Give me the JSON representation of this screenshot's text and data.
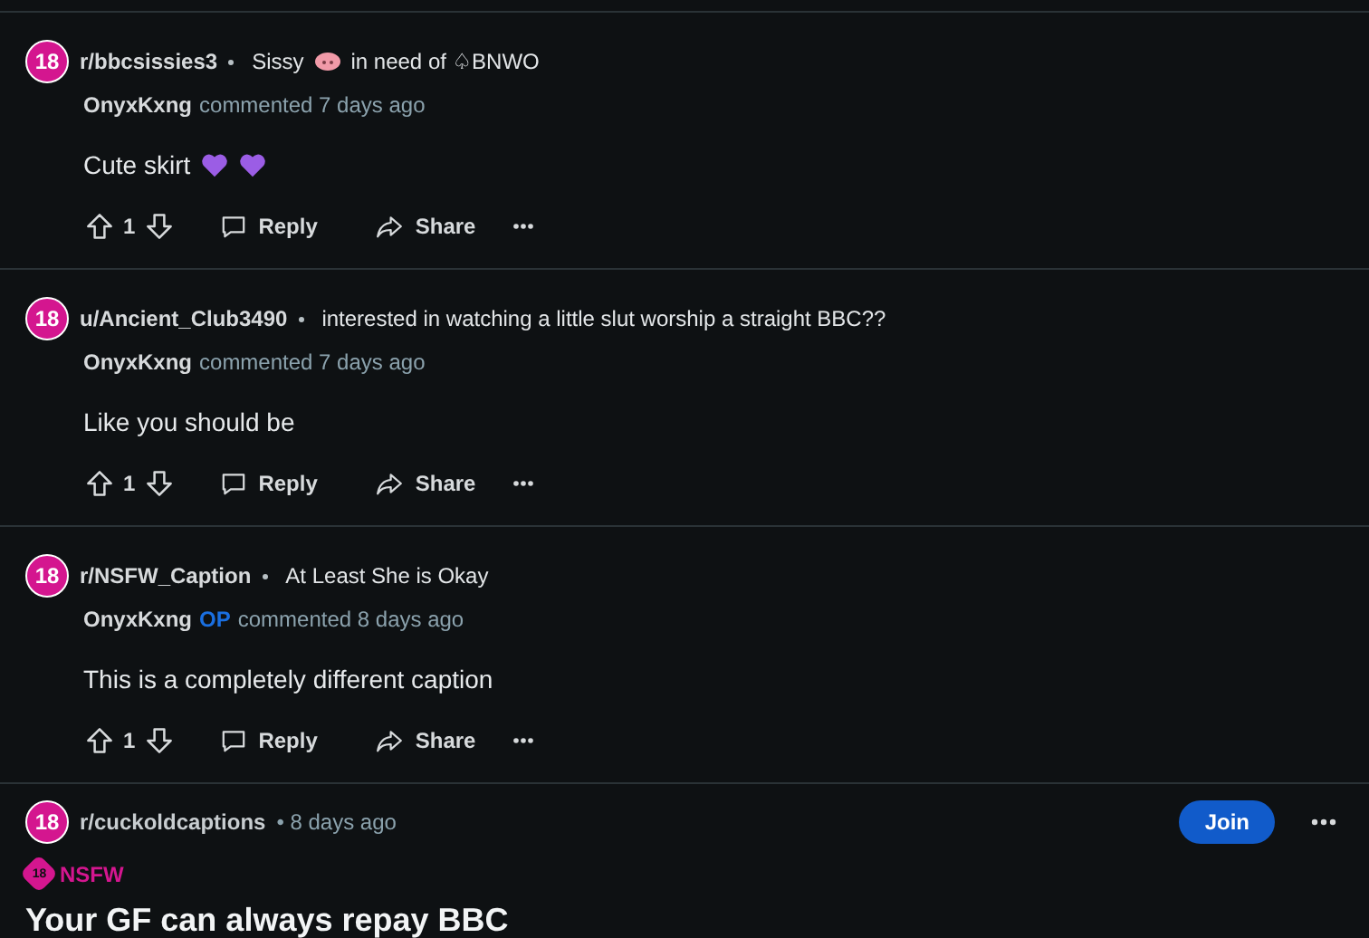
{
  "comments": [
    {
      "avatar": "18",
      "community": "r/bbcsissies3",
      "title": [
        {
          "kind": "text",
          "text": "Sissy"
        },
        {
          "kind": "pig"
        },
        {
          "kind": "text",
          "text": "in need of ♤BNWO"
        }
      ],
      "author": "OnyxKxng",
      "meta": "commented 7 days ago",
      "body": [
        {
          "kind": "text",
          "text": "Cute skirt"
        },
        {
          "kind": "heart"
        },
        {
          "kind": "heart"
        }
      ],
      "score": "1",
      "reply": "Reply",
      "share": "Share"
    },
    {
      "avatar": "18",
      "community": "u/Ancient_Club3490",
      "title": [
        {
          "kind": "text",
          "text": "interested in watching a little slut worship a straight BBC??"
        }
      ],
      "author": "OnyxKxng",
      "meta": "commented 7 days ago",
      "body": [
        {
          "kind": "text",
          "text": "Like you should be"
        }
      ],
      "score": "1",
      "reply": "Reply",
      "share": "Share"
    },
    {
      "avatar": "18",
      "community": "r/NSFW_Caption",
      "title": [
        {
          "kind": "text",
          "text": "At Least She is Okay"
        }
      ],
      "author": "OnyxKxng",
      "badge": "OP",
      "meta": "commented 8 days ago",
      "body": [
        {
          "kind": "text",
          "text": "This is a completely different caption"
        }
      ],
      "score": "1",
      "reply": "Reply",
      "share": "Share"
    }
  ],
  "post": {
    "avatar": "18",
    "community": "r/cuckoldcaptions",
    "time": "• 8 days ago",
    "join": "Join",
    "nsfw_icon": "18",
    "nsfw": "NSFW",
    "title": "Your GF can always repay BBC"
  }
}
